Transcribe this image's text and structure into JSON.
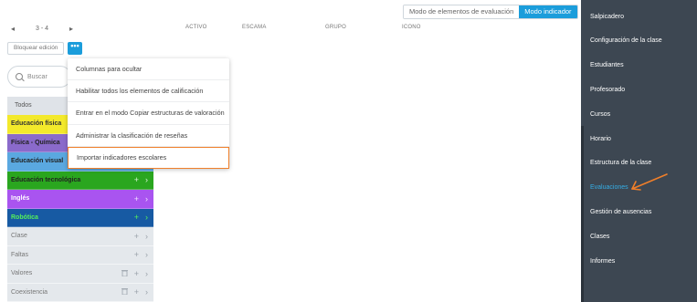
{
  "header": {
    "pager": {
      "prev_icon": "chevron-left-icon",
      "range": "3 - 4",
      "next_icon": "chevron-right-icon"
    },
    "columns": [
      "ACTIVO",
      "ESCAMA",
      "GRUPO",
      "ICONO"
    ],
    "modes": [
      "Modo de elementos de evaluación",
      "Modo indicador"
    ],
    "lock_label": "Bloquear edición",
    "more_label": "•••"
  },
  "search": {
    "placeholder": "Buscar",
    "icon": "search-icon"
  },
  "menu": {
    "items": [
      "Columnas para ocultar",
      "Habilitar todos los elementos de calificación",
      "Entrar en el modo Copiar estructuras de valoración",
      "Administrar la clasificación de reseñas",
      "Importar indicadores escolares"
    ],
    "highlight_index": 4,
    "highlight_color": "#f07f2a"
  },
  "categories": {
    "all_label": "Todos",
    "items": [
      {
        "label": "Educación física",
        "color": "#f3e92b",
        "text_color": "#333333"
      },
      {
        "label": "Física - Química",
        "color": "#8a6acb",
        "text_color": "#222222"
      },
      {
        "label": "Educación visual",
        "color": "#5aa8e0",
        "text_color": "#222222"
      },
      {
        "label": "Educación tecnológica",
        "color": "#2aa61f",
        "text_color": "#222222"
      },
      {
        "label": "Inglés",
        "color": "#a954f0",
        "text_color": "#ffffff"
      },
      {
        "label": "Robótica",
        "color": "#175aa3",
        "text_color": "#54f05a"
      },
      {
        "label": "Clase",
        "color": "#e4e8ec",
        "text_color": "#777777"
      },
      {
        "label": "Faltas",
        "color": "#e4e8ec",
        "text_color": "#777777"
      },
      {
        "label": "Valores",
        "color": "#e4e8ec",
        "text_color": "#777777"
      },
      {
        "label": "Coexistencia",
        "color": "#e4e8ec",
        "text_color": "#777777"
      }
    ],
    "plus": "+",
    "chevron": "›",
    "trash_icon": "trash-icon"
  },
  "sidebar": {
    "items": [
      "Salpicadero",
      "Configuración de la clase",
      "Estudiantes",
      "Profesorado",
      "Cursos",
      "Horario",
      "Estructura de la clase",
      "Evaluaciones",
      "Gestión de ausencias",
      "Clases",
      "Informes"
    ],
    "active_index": 7,
    "annotation_arrow": "arrow-annotation-icon"
  },
  "colors": {
    "accent": "#1b9ddb",
    "sidebar_bg": "#3d4752",
    "active_link": "#35aee6",
    "annotation": "#f07f2a"
  }
}
